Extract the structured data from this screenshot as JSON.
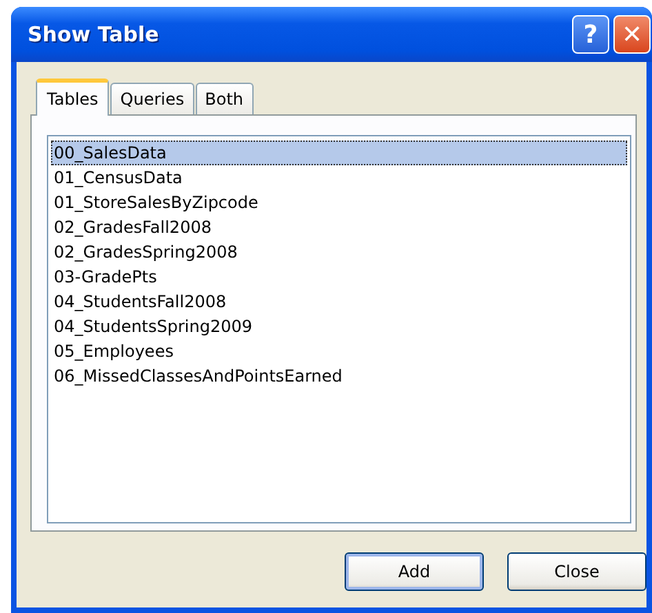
{
  "window": {
    "title": "Show Table"
  },
  "title_buttons": [
    {
      "kind": "help",
      "label": "?"
    },
    {
      "kind": "close",
      "label": "✕"
    }
  ],
  "tabs": [
    {
      "label": "Tables",
      "selected": true
    },
    {
      "label": "Queries",
      "selected": false
    },
    {
      "label": "Both",
      "selected": false
    }
  ],
  "list": {
    "items": [
      {
        "label": "00_SalesData",
        "selected": true
      },
      {
        "label": "01_CensusData",
        "selected": false
      },
      {
        "label": "01_StoreSalesByZipcode",
        "selected": false
      },
      {
        "label": "02_GradesFall2008",
        "selected": false
      },
      {
        "label": "02_GradesSpring2008",
        "selected": false
      },
      {
        "label": "03-GradePts",
        "selected": false
      },
      {
        "label": "04_StudentsFall2008",
        "selected": false
      },
      {
        "label": "04_StudentsSpring2009",
        "selected": false
      },
      {
        "label": "05_Employees",
        "selected": false
      },
      {
        "label": "06_MissedClassesAndPointsEarned",
        "selected": false
      }
    ]
  },
  "buttons": [
    {
      "label": "Add",
      "default": true
    },
    {
      "label": "Close",
      "default": false
    }
  ]
}
